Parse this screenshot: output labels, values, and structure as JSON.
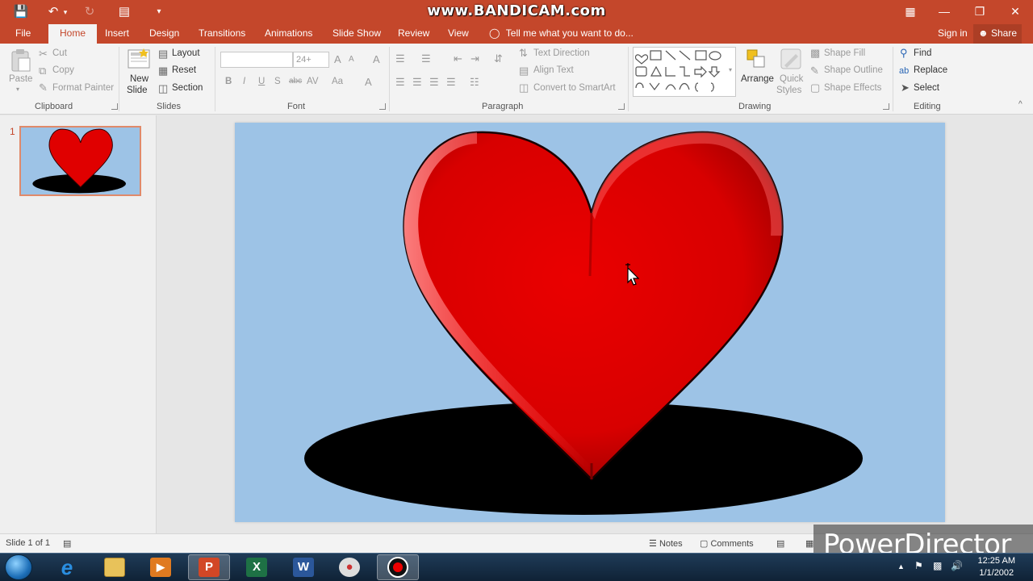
{
  "recorder_watermark": "www.BANDICAM.com",
  "tabs": [
    {
      "label": "File",
      "active": false
    },
    {
      "label": "Home",
      "active": true
    },
    {
      "label": "Insert",
      "active": false
    },
    {
      "label": "Design",
      "active": false
    },
    {
      "label": "Transitions",
      "active": false
    },
    {
      "label": "Animations",
      "active": false
    },
    {
      "label": "Slide Show",
      "active": false
    },
    {
      "label": "Review",
      "active": false
    },
    {
      "label": "View",
      "active": false
    }
  ],
  "tell_me": "Tell me what you want to do...",
  "sign_in": "Sign in",
  "share": "Share",
  "clipboard": {
    "paste": "Paste",
    "cut": "Cut",
    "copy": "Copy",
    "format_painter": "Format Painter",
    "group": "Clipboard"
  },
  "slides_group": {
    "new_slide": "New",
    "new_slide_2": "Slide",
    "layout": "Layout",
    "reset": "Reset",
    "section": "Section",
    "group": "Slides"
  },
  "font": {
    "size": "24+",
    "group": "Font",
    "bold": "B",
    "italic": "I",
    "underline": "U",
    "shadow": "S",
    "strike": "abc",
    "spacing": "AV",
    "case": "Aa",
    "grow": "A",
    "shrink": "A",
    "clear": "A"
  },
  "paragraph": {
    "text_direction": "Text Direction",
    "align_text": "Align Text",
    "convert_smartart": "Convert to SmartArt",
    "group": "Paragraph"
  },
  "drawing": {
    "arrange": "Arrange",
    "quick": "Quick",
    "styles": "Styles",
    "shape_fill": "Shape Fill",
    "shape_outline": "Shape Outline",
    "shape_effects": "Shape Effects",
    "group": "Drawing"
  },
  "editing": {
    "find": "Find",
    "replace": "Replace",
    "select": "Select",
    "group": "Editing"
  },
  "slide_number": "1",
  "status": {
    "slide_of": "Slide 1 of 1",
    "notes": "Notes",
    "comments": "Comments"
  },
  "editor_watermark": "PowerDirector",
  "clock": {
    "time": "12:25 AM",
    "date": "1/1/2002"
  },
  "colors": {
    "accent": "#c4472b",
    "slide_bg": "#9dc3e6",
    "heart": "#e00000"
  },
  "icons": [
    "save-icon",
    "undo-icon",
    "redo-icon",
    "start-from-beginning-icon",
    "customize-icon",
    "ribbon-display-icon",
    "minimize-icon",
    "maximize-icon",
    "close-icon",
    "lightbulb-icon",
    "person-icon",
    "start-orb-icon",
    "ie-icon",
    "folder-icon",
    "media-player-icon",
    "powerpoint-icon",
    "excel-icon",
    "word-icon",
    "paint-icon",
    "record-icon",
    "flag-icon",
    "network-icon",
    "volume-icon"
  ]
}
